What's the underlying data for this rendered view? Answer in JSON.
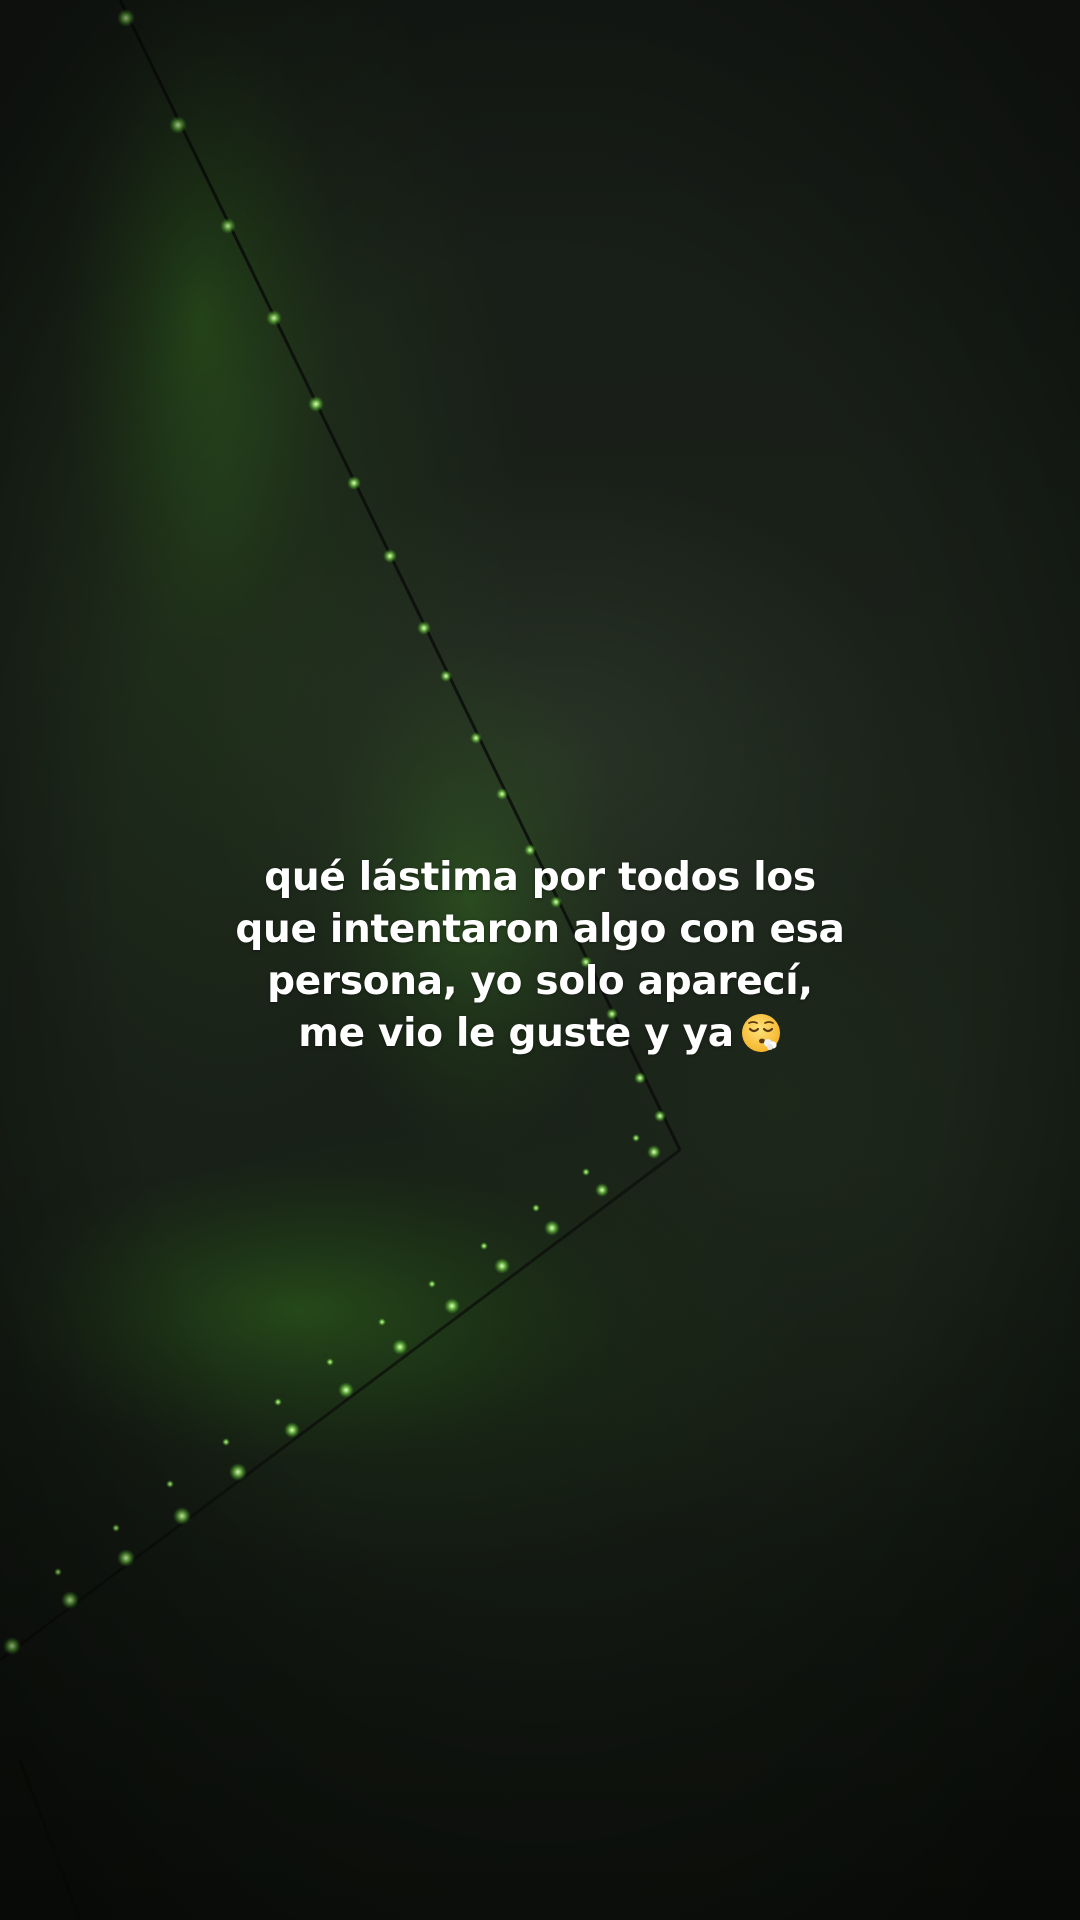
{
  "caption": {
    "line1": "qué lástima por todos los",
    "line2": "que intentaron algo con esa",
    "line3": "persona, yo solo aparecí,",
    "line4": "me vio le guste y ya",
    "emoji": "face-exhaling-emoji"
  },
  "colors": {
    "background": "#161b15",
    "light_glow": "#5fd43a",
    "text": "#ffffff"
  }
}
